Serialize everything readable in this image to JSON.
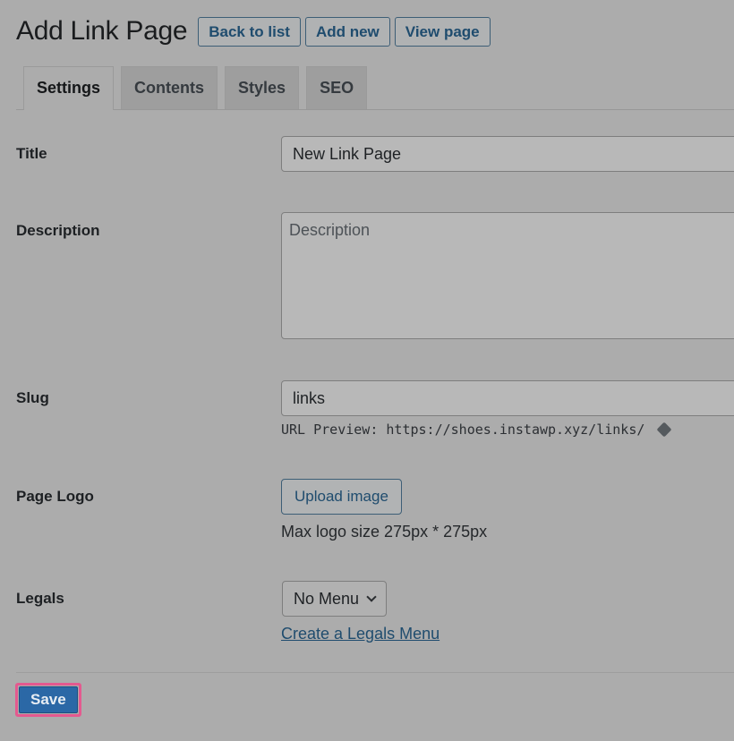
{
  "header": {
    "title": "Add Link Page",
    "buttons": {
      "back_to_list": "Back to list",
      "add_new": "Add new",
      "view_page": "View page"
    }
  },
  "tabs": [
    {
      "label": "Settings",
      "active": true
    },
    {
      "label": "Contents",
      "active": false
    },
    {
      "label": "Styles",
      "active": false
    },
    {
      "label": "SEO",
      "active": false
    }
  ],
  "form": {
    "title": {
      "label": "Title",
      "value": "New Link Page"
    },
    "description": {
      "label": "Description",
      "value": "",
      "placeholder": "Description"
    },
    "slug": {
      "label": "Slug",
      "value": "links",
      "url_preview": "URL Preview: https://shoes.instawp.xyz/links/",
      "icon": "tag-icon"
    },
    "page_logo": {
      "label": "Page Logo",
      "button": "Upload image",
      "help": "Max logo size 275px * 275px"
    },
    "legals": {
      "label": "Legals",
      "selected": "No Menu",
      "icon": "chevron-down-icon",
      "link": "Create a Legals Menu"
    }
  },
  "footer": {
    "save_label": "Save",
    "highlight_color": "#e4598f",
    "primary_color": "#2b68a6"
  }
}
